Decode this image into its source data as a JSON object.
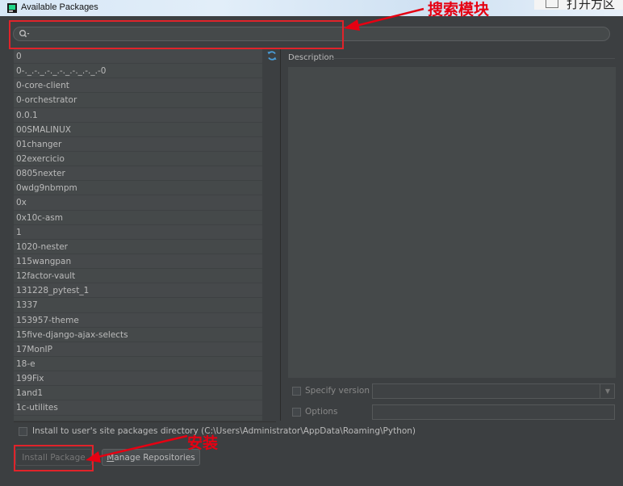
{
  "window": {
    "title": "Available Packages",
    "external_fragment": "打开方区"
  },
  "search": {
    "value": "",
    "placeholder": ""
  },
  "packages": [
    "0",
    "0-._.-._.-._.-._.-._.-._.-0",
    "0-core-client",
    "0-orchestrator",
    "0.0.1",
    "00SMALINUX",
    "01changer",
    "02exercicio",
    "0805nexter",
    "0wdg9nbmpm",
    "0x",
    "0x10c-asm",
    "1",
    "1020-nester",
    "115wangpan",
    "12factor-vault",
    "131228_pytest_1",
    "1337",
    "153957-theme",
    "15five-django-ajax-selects",
    "17MonIP",
    "18-e",
    "199Fix",
    "1and1",
    "1c-utilites"
  ],
  "description": {
    "label": "Description"
  },
  "options": {
    "specify_version_label": "Specify version",
    "version_value": "",
    "options_label": "Options",
    "options_value": ""
  },
  "install_user_site": {
    "label": "Install to user's site packages directory (C:\\Users\\Administrator\\AppData\\Roaming\\Python)"
  },
  "buttons": {
    "install_label": "Install Package",
    "manage_prefix": "M",
    "manage_rest": "anage Repositories"
  },
  "annotations": {
    "search": "搜索模块",
    "install": "安装"
  },
  "colors": {
    "annotation_red": "#e60012",
    "refresh_blue": "#4a9eda",
    "background": "#3c3f41"
  },
  "icons": {
    "search": "search-icon",
    "refresh": "refresh-icon",
    "app": "pycharm-icon",
    "dropdown": "chevron-down-icon"
  }
}
